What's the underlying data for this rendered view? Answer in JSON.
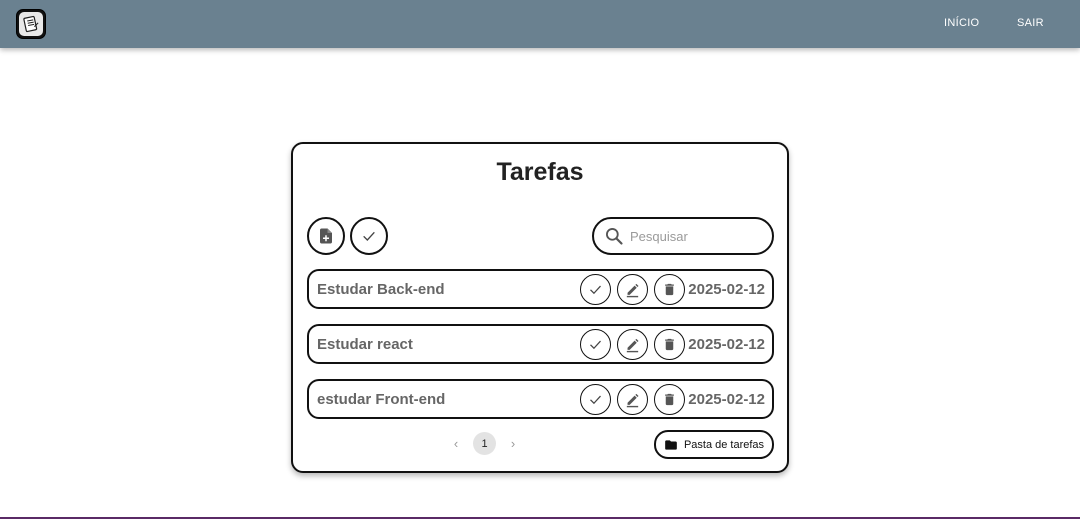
{
  "nav": {
    "logo_icon": "notepad-logo-icon",
    "links": [
      {
        "label": "INÍCIO"
      },
      {
        "label": "SAIR"
      }
    ]
  },
  "card": {
    "title": "Tarefas",
    "toolbar": {
      "add_icon": "file-plus-icon",
      "check_all_icon": "check-icon"
    },
    "search": {
      "placeholder": "Pesquisar",
      "value": "",
      "icon": "search-icon"
    },
    "tasks": [
      {
        "title": "Estudar Back-end",
        "date": "2025-02-12"
      },
      {
        "title": "Estudar react",
        "date": "2025-02-12"
      },
      {
        "title": "estudar Front-end",
        "date": "2025-02-12"
      }
    ],
    "pagination": {
      "prev": "‹",
      "current": "1",
      "next": "›"
    },
    "folder_button": {
      "label": "Pasta de tarefas",
      "icon": "folder-icon"
    }
  },
  "colors": {
    "topbar": "#6a8190",
    "task_text": "#666666",
    "border": "#111111"
  }
}
